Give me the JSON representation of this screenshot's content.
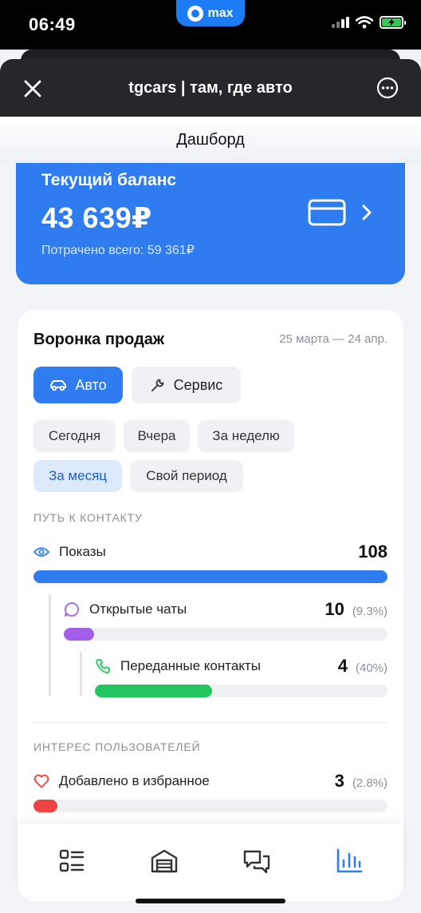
{
  "status_bar": {
    "time": "06:49",
    "pill_label": "max"
  },
  "header": {
    "title": "tgcars | там, где авто"
  },
  "page": {
    "title": "Дашборд"
  },
  "balance": {
    "label": "Текущий баланс",
    "amount": "43 639₽",
    "spent": "Потрачено всего: 59 361₽"
  },
  "funnel": {
    "title": "Воронка продаж",
    "date_range": "25 марта — 24 апр.",
    "type_buttons": {
      "auto": "Авто",
      "service": "Сервис"
    },
    "periods": [
      "Сегодня",
      "Вчера",
      "За неделю",
      "За месяц",
      "Свой период"
    ],
    "selected_period": "За месяц",
    "path_label": "ПУТЬ К КОНТАКТУ",
    "metrics": [
      {
        "label": "Показы",
        "value": "108",
        "percent": "",
        "fill": 1.0,
        "color": "#2f7bf0"
      },
      {
        "label": "Открытые чаты",
        "value": "10",
        "percent": "(9.3%)",
        "fill": 0.093,
        "color": "#a35ee8"
      },
      {
        "label": "Переданные контакты",
        "value": "4",
        "percent": "(40%)",
        "fill": 0.4,
        "color": "#22c55e"
      }
    ],
    "interest_label": "ИНТЕРЕС ПОЛЬЗОВАТЕЛЕЙ",
    "interest": [
      {
        "label": "Добавлено в избранное",
        "value": "3",
        "percent": "(2.8%)",
        "fill": 0.028,
        "color": "#ef4444"
      }
    ]
  },
  "tabbar": {
    "icons": [
      "list-icon",
      "garage-icon",
      "chats-icon",
      "stats-icon"
    ],
    "active": "stats-icon",
    "accent": "#2f7bf0"
  }
}
